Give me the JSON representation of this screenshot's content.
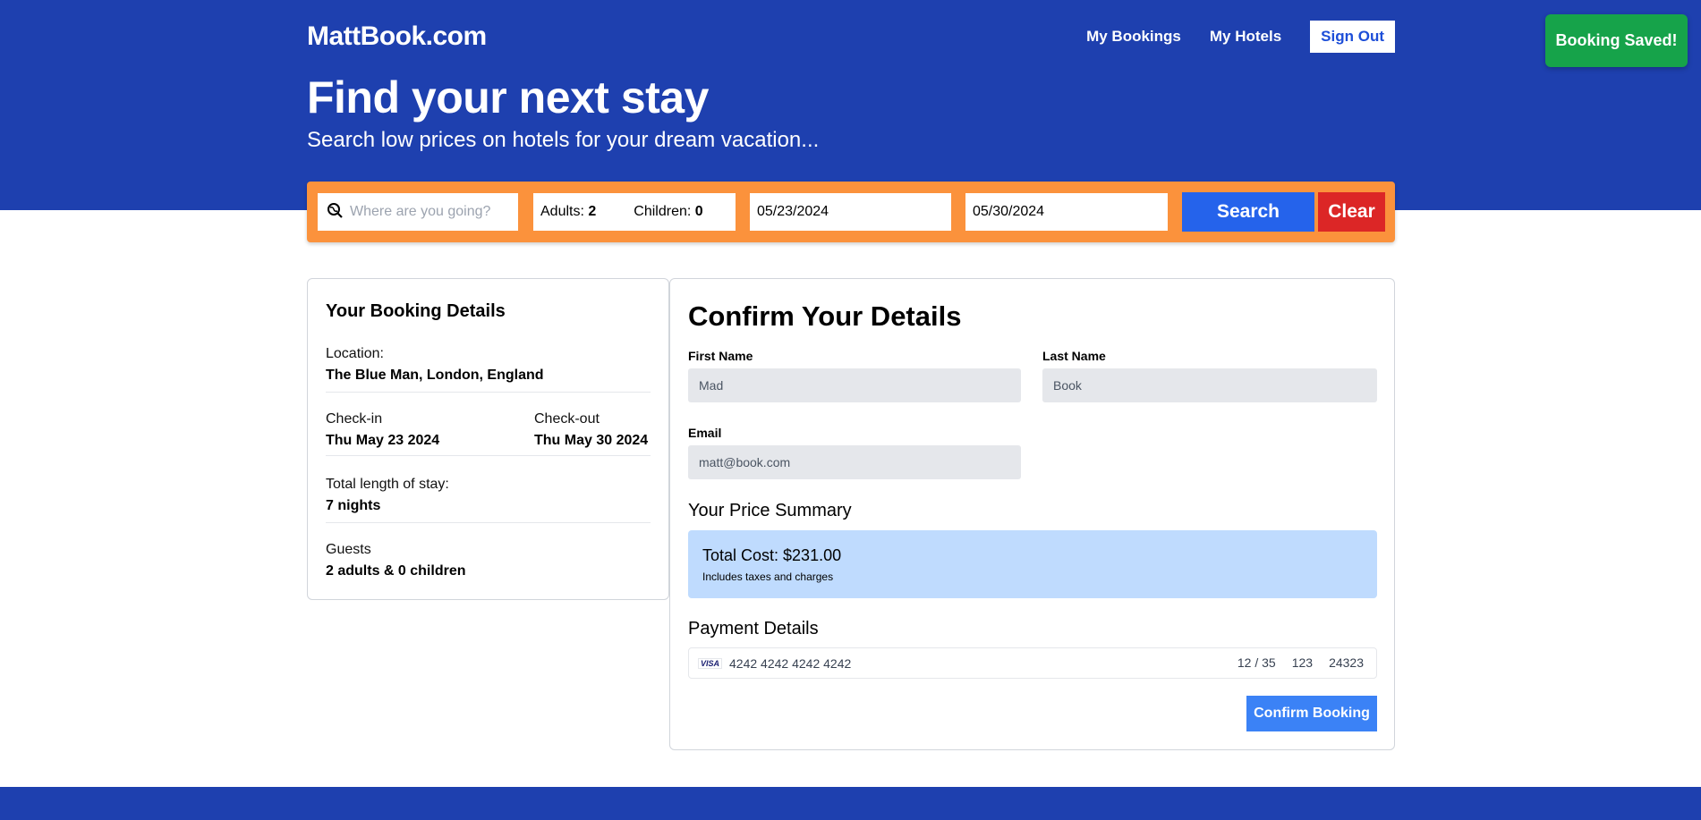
{
  "header": {
    "logo": "MattBook.com",
    "nav": {
      "my_bookings": "My Bookings",
      "my_hotels": "My Hotels",
      "sign_out": "Sign Out"
    },
    "title": "Find your next stay",
    "subtitle": "Search low prices on hotels for your dream vacation..."
  },
  "toast": {
    "message": "Booking Saved!"
  },
  "search": {
    "destination_placeholder": "Where are you going?",
    "adults_label": "Adults:",
    "adults_value": "2",
    "children_label": "Children:",
    "children_value": "0",
    "check_in": "05/23/2024",
    "check_out": "05/30/2024",
    "search_label": "Search",
    "clear_label": "Clear"
  },
  "booking_details": {
    "title": "Your Booking Details",
    "location_label": "Location:",
    "location_value": "The Blue Man, London, England",
    "checkin_label": "Check-in",
    "checkin_value": "Thu May 23 2024",
    "checkout_label": "Check-out",
    "checkout_value": "Thu May 30 2024",
    "length_label": "Total length of stay:",
    "length_value": "7 nights",
    "guests_label": "Guests",
    "guests_value": "2 adults & 0 children"
  },
  "confirm": {
    "title": "Confirm Your Details",
    "first_name_label": "First Name",
    "first_name_value": "Mad",
    "last_name_label": "Last Name",
    "last_name_value": "Book",
    "email_label": "Email",
    "email_value": "matt@book.com",
    "price_title": "Your Price Summary",
    "total_cost": "Total Cost: $231.00",
    "price_note": "Includes taxes and charges",
    "payment_title": "Payment Details",
    "card_brand": "VISA",
    "card_number": "4242 4242 4242 4242",
    "card_expiry": "12 / 35",
    "card_cvc": "123",
    "card_zip": "24323",
    "confirm_label": "Confirm Booking"
  },
  "colors": {
    "primary": "#1e40af",
    "search_bar": "#fb923c",
    "search_button": "#2563eb",
    "clear_button": "#dc2626",
    "toast": "#16a34a",
    "price_box": "#bfdbfe",
    "confirm_button": "#3b82f6"
  },
  "icons": {
    "destination": "search-globe-icon",
    "card": "visa-card-icon"
  }
}
